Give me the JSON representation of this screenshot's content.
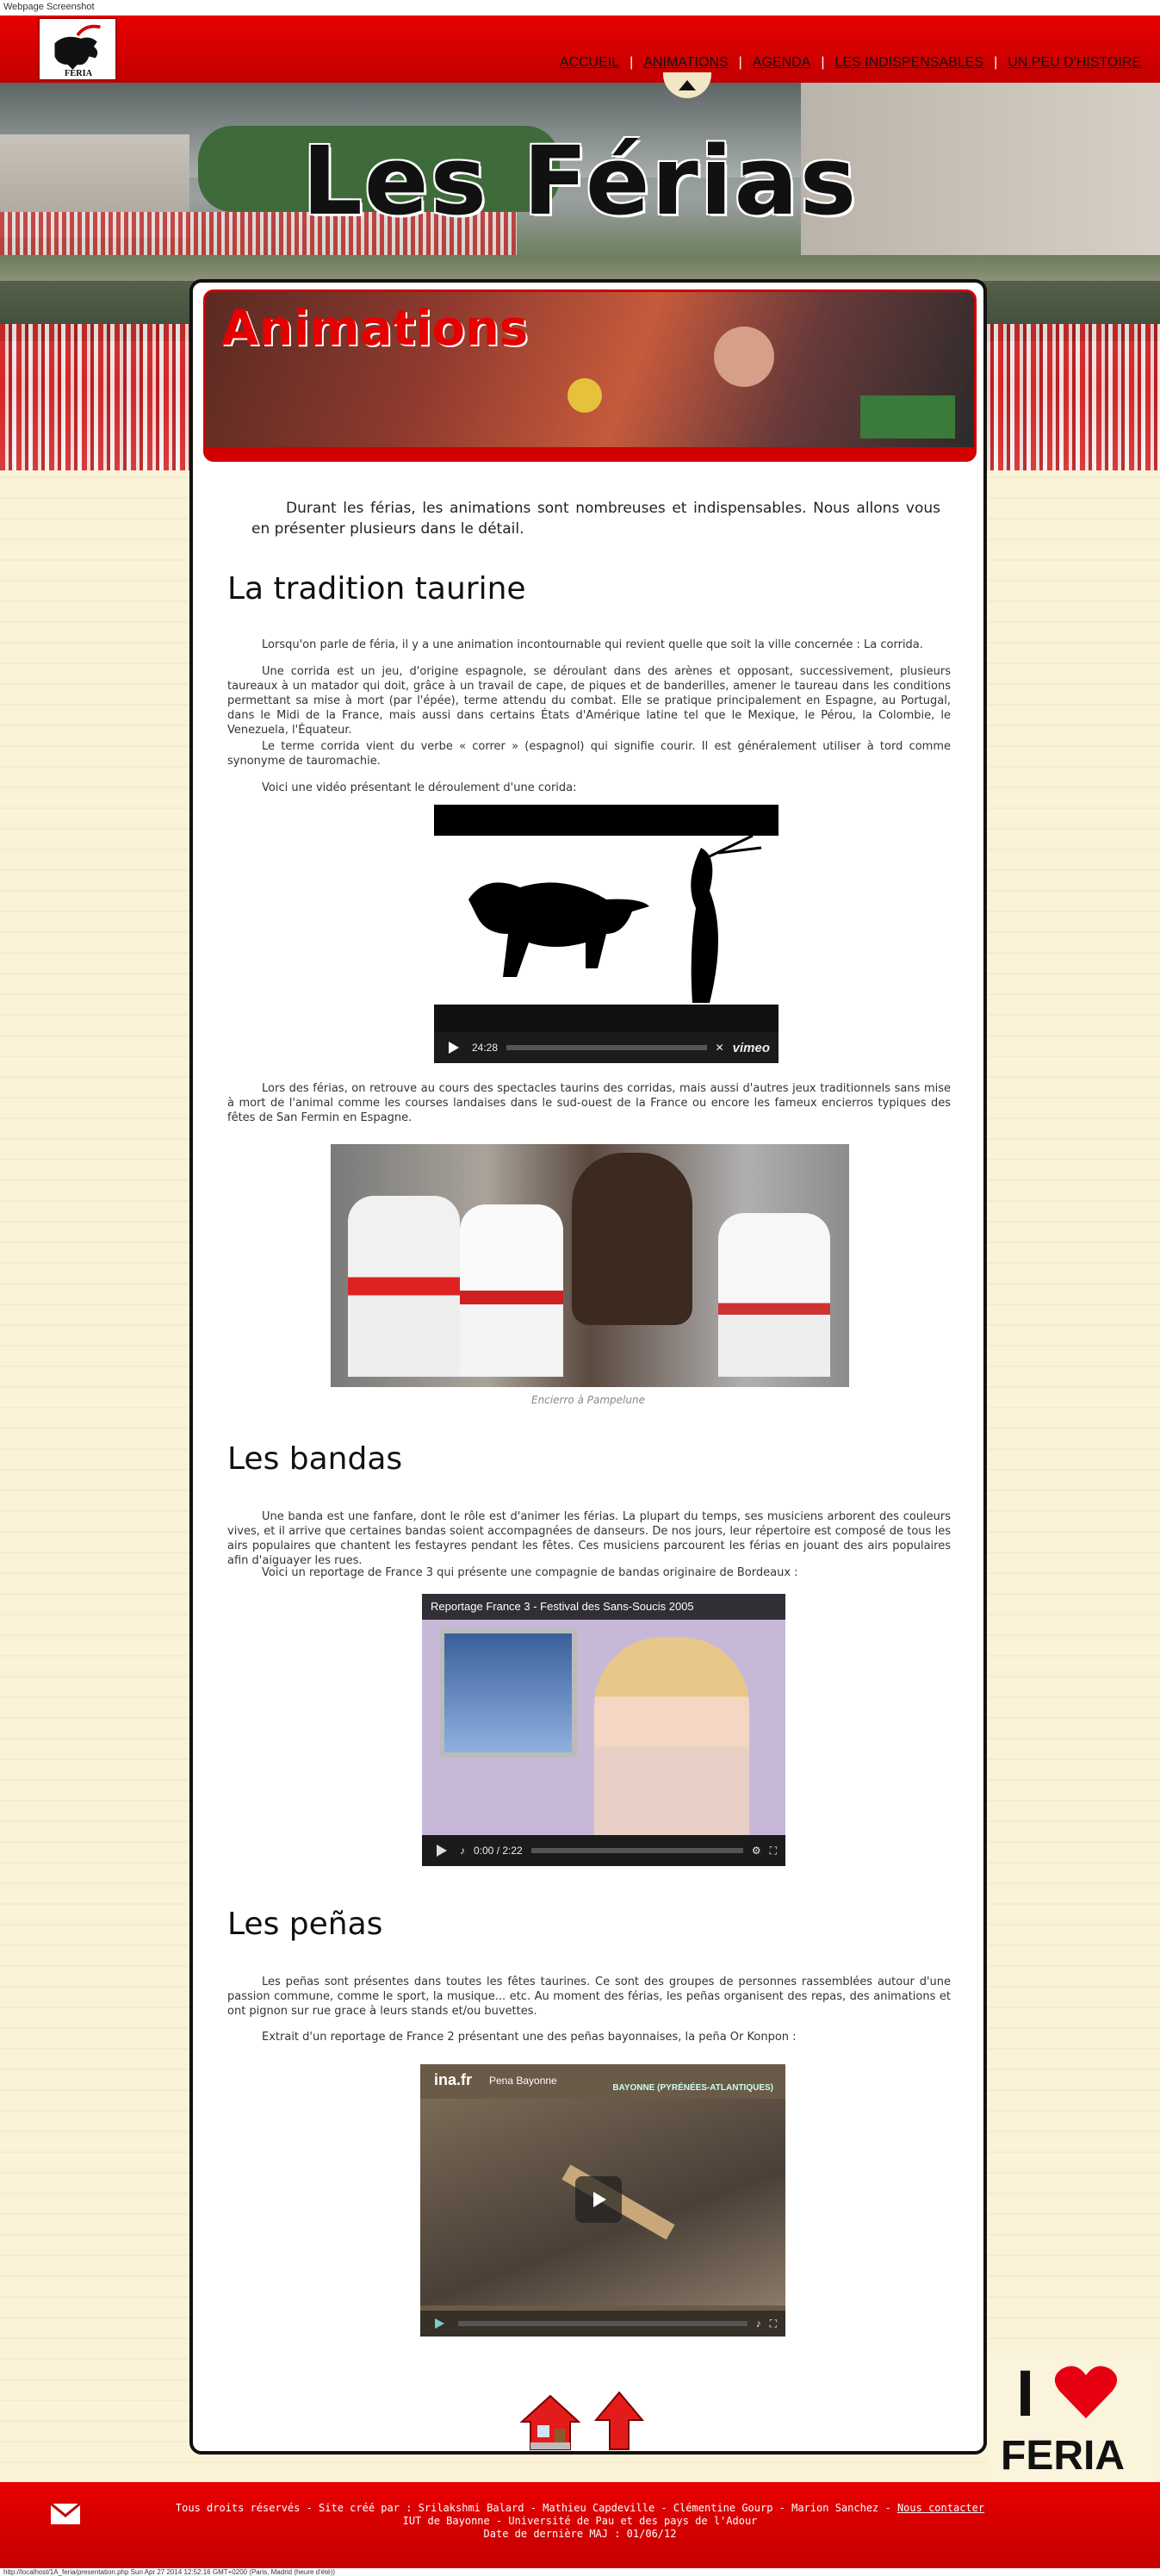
{
  "caption_top": "Webpage Screenshot",
  "nav": {
    "items": [
      "ACCUEIL",
      "ANIMATIONS",
      "AGENDA",
      "LES INDISPENSABLES",
      "UN PEU D'HISTOIRE"
    ],
    "separator": "|"
  },
  "header": {
    "site_title": "Les Férias",
    "logo_text": "FÉRIA"
  },
  "page": {
    "banner_title": "Animations",
    "intro": "Durant les férias, les animations sont nombreuses et indispensables. Nous allons vous en présenter plusieurs dans le détail."
  },
  "taurine": {
    "title": "La tradition taurine",
    "p1": "Lorsqu'on parle de féria, il y a une animation incontournable qui revient quelle que soit la ville concernée : La corrida.",
    "p2": "Une corrida est un jeu, d'origine espagnole, se déroulant dans des arènes et opposant, successivement, plusieurs taureaux à un matador qui doit, grâce à un travail de cape, de piques et de banderilles, amener le taureau dans les conditions permettant sa mise à mort (par l'épée), terme attendu du combat. Elle se pratique principalement en Espagne, au Portugal, dans le Midi de la France, mais aussi dans certains États d'Amérique latine tel que le Mexique, le Pérou, la Colombie, le Venezuela, l'Équateur.",
    "p3": "Le terme corrida vient du verbe « correr » (espagnol) qui signifie courir. Il est généralement utiliser à tord comme synonyme de tauromachie.",
    "p4": "Voici une vidéo présentant le déroulement d'une corida:",
    "video_time": "24:28",
    "video_brand": "vimeo",
    "p5": "Lors des férias, on retrouve au cours des spectacles taurins des corridas, mais aussi d'autres jeux traditionnels sans mise à mort de l'animal comme les courses landaises dans le sud-ouest de la France ou encore les fameux encierros typiques des fêtes de San Fermin en Espagne.",
    "photo_caption": "Encierro à Pampelune"
  },
  "bandas": {
    "title": "Les bandas",
    "p1": "Une banda est une fanfare, dont le rôle est d'animer les férias. La plupart du temps, ses musiciens arborent des couleurs vives, et il arrive que certaines bandas soient accompagnées de danseurs. De nos jours, leur répertoire est composé de tous les airs populaires que chantent les festayres pendant les fêtes. Ces musiciens parcourent les férias en jouant des airs populaires afin d'aiguayer les rues.",
    "p2": "Voici un reportage de France 3 qui présente une compagnie de bandas originaire de Bordeaux :",
    "video_title": "Reportage France 3 - Festival des Sans-Soucis 2005",
    "video_time": "0:00 / 2:22",
    "video_progress": 0.0
  },
  "penas": {
    "title": "Les peñas",
    "p1": "Les peñas sont présentes dans toutes les fêtes taurines. Ce sont des groupes de personnes rassemblées autour d'une passion commune, comme le sport, la musique... etc. Au moment des férias, les peñas organisent des repas, des animations et ont pignon sur rue grace à leurs stands et/ou buvettes.",
    "p2": "Extrait d'un reportage de France 2 présentant une des peñas bayonnaises, la peña Or Konpon :",
    "video_brand": "ina.fr",
    "video_title": "Pena Bayonne",
    "video_overlay": "BAYONNE (PYRÉNÉES-ATLANTIQUES)"
  },
  "badge": {
    "line1": "I",
    "line2": "FERIA"
  },
  "footer": {
    "line1": "Tous droits réservés - Site créé par : Srilakshmi Balard - Mathieu Capdeville - Clémentine Gourp - Marion Sanchez - ",
    "contact": "Nous contacter",
    "line2": "IUT de Bayonne - Université de Pau et des pays de l'Adour",
    "line3": "Date de dernière MAJ : 01/06/12"
  },
  "caption_bottom": "http://localhost/1A_feria/presentation.php Sun Apr 27 2014 12:52:16 GMT+0200 (Paris, Madrid (heure d'été))",
  "colors": {
    "accent": "#d20000",
    "background": "#fbf4dc"
  }
}
